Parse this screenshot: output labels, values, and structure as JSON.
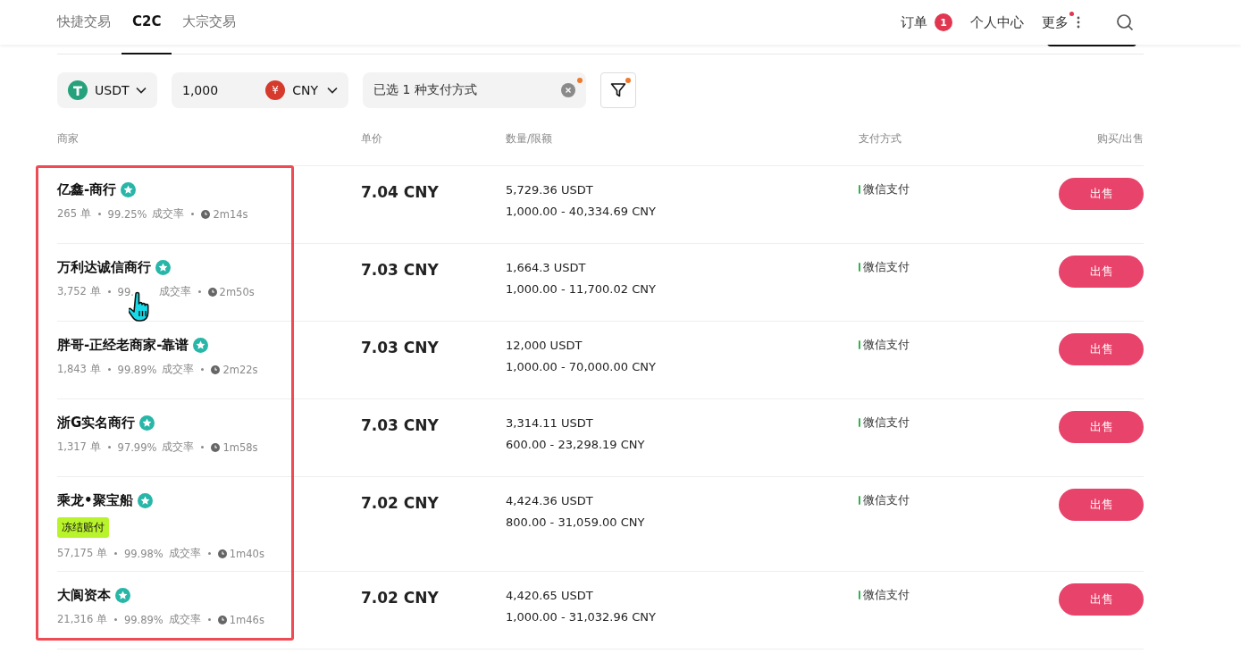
{
  "nav": {
    "tabs": [
      {
        "label": "快捷交易",
        "selected": false
      },
      {
        "label": "C2C",
        "selected": true
      },
      {
        "label": "大宗交易",
        "selected": false
      }
    ],
    "orders": {
      "label": "订单",
      "badge": "1"
    },
    "account": "个人中心",
    "more": {
      "label": "更多",
      "dot": true
    }
  },
  "filters": {
    "coin": "USDT",
    "amount": "1,000",
    "currency_symbol": "¥",
    "currency": "CNY",
    "payment": {
      "label": "已选 1 种支付方式",
      "dot": true
    },
    "filter_dot": true
  },
  "table": {
    "columns": [
      "商家",
      "单价",
      "数量/限额",
      "支付方式",
      "购买/出售"
    ],
    "rows": [
      {
        "merchant": "亿鑫-商行",
        "hovered": false,
        "orders": "265 单",
        "rate": "99.25%",
        "rate_label": "成交率",
        "time": "2m14s",
        "price": "7.04 CNY",
        "quantity": "5,729.36 USDT",
        "limit": "1,000.00 - 40,334.69 CNY",
        "payment": "微信支付",
        "action": "出售"
      },
      {
        "merchant": "万利达诚信商行",
        "hovered": true,
        "orders": "3,752 单",
        "rate": "99.",
        "rate_label": "成交率",
        "time": "2m50s",
        "price": "7.03 CNY",
        "quantity": "1,664.3 USDT",
        "limit": "1,000.00 - 11,700.02 CNY",
        "payment": "微信支付",
        "action": "出售"
      },
      {
        "merchant": "胖哥-正经老商家-靠谱",
        "hovered": false,
        "orders": "1,843 单",
        "rate": "99.89%",
        "rate_label": "成交率",
        "time": "2m22s",
        "price": "7.03 CNY",
        "quantity": "12,000 USDT",
        "limit": "1,000.00 - 70,000.00 CNY",
        "payment": "微信支付",
        "action": "出售"
      },
      {
        "merchant": "浙G实名商行",
        "hovered": false,
        "orders": "1,317 单",
        "rate": "97.99%",
        "rate_label": "成交率",
        "time": "1m58s",
        "price": "7.03 CNY",
        "quantity": "3,314.11 USDT",
        "limit": "600.00 - 23,298.19 CNY",
        "payment": "微信支付",
        "action": "出售"
      },
      {
        "merchant": "乘龙•聚宝船",
        "tag": "冻结赔付",
        "hovered": false,
        "orders": "57,175 单",
        "rate": "99.98%",
        "rate_label": "成交率",
        "time": "1m40s",
        "price": "7.02 CNY",
        "quantity": "4,424.36 USDT",
        "limit": "800.00 - 31,059.00 CNY",
        "payment": "微信支付",
        "action": "出售"
      },
      {
        "merchant": "大阆资本",
        "hovered": false,
        "orders": "21,316 单",
        "rate": "99.89%",
        "rate_label": "成交率",
        "time": "1m46s",
        "price": "7.02 CNY",
        "quantity": "4,420.65 USDT",
        "limit": "1,000.00 - 31,032.96 CNY",
        "payment": "微信支付",
        "action": "出售"
      }
    ]
  }
}
